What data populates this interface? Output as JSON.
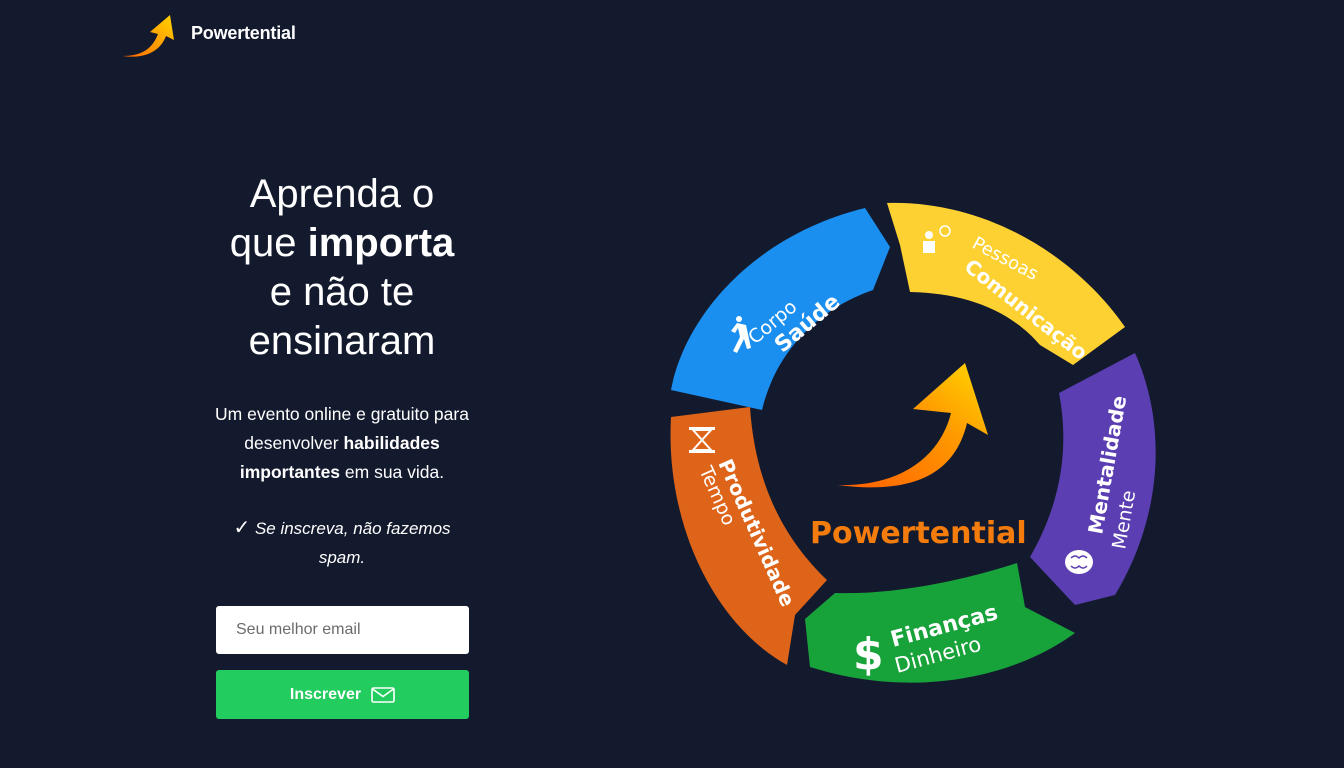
{
  "brand": {
    "name": "Powertential"
  },
  "hero": {
    "line1": "Aprenda o",
    "line2_a": "que ",
    "line2_b": "importa",
    "line3": "e não te",
    "line4": "ensinaram",
    "sub_a": "Um evento online e gratuito para desenvolver ",
    "sub_b": "habilidades importantes",
    "sub_c": " em sua vida.",
    "check": "✓",
    "note": "Se inscreva, não fazemos spam."
  },
  "form": {
    "email_placeholder": "Seu melhor email",
    "submit_label": "Inscrever"
  },
  "wheel": {
    "center_label": "Powertential",
    "segments": [
      {
        "title": "Saúde",
        "subtitle": "Corpo",
        "color": "#1a8ff0",
        "icon": "runner-icon"
      },
      {
        "title": "Comunicação",
        "subtitle": "Pessoas",
        "color": "#fdd132",
        "icon": "people-talking-icon"
      },
      {
        "title": "Mentalidade",
        "subtitle": "Mente",
        "color": "#5b3fb2",
        "icon": "brain-icon"
      },
      {
        "title": "Finanças",
        "subtitle": "Dinheiro",
        "color": "#18a23a",
        "icon": "dollar-icon"
      },
      {
        "title": "Produtividade",
        "subtitle": "Tempo",
        "color": "#de6419",
        "icon": "hourglass-icon"
      }
    ]
  },
  "colors": {
    "background": "#141a2e",
    "button": "#22cc5e",
    "accent_orange": "#f47c0c",
    "accent_yellow": "#ffc21a"
  }
}
